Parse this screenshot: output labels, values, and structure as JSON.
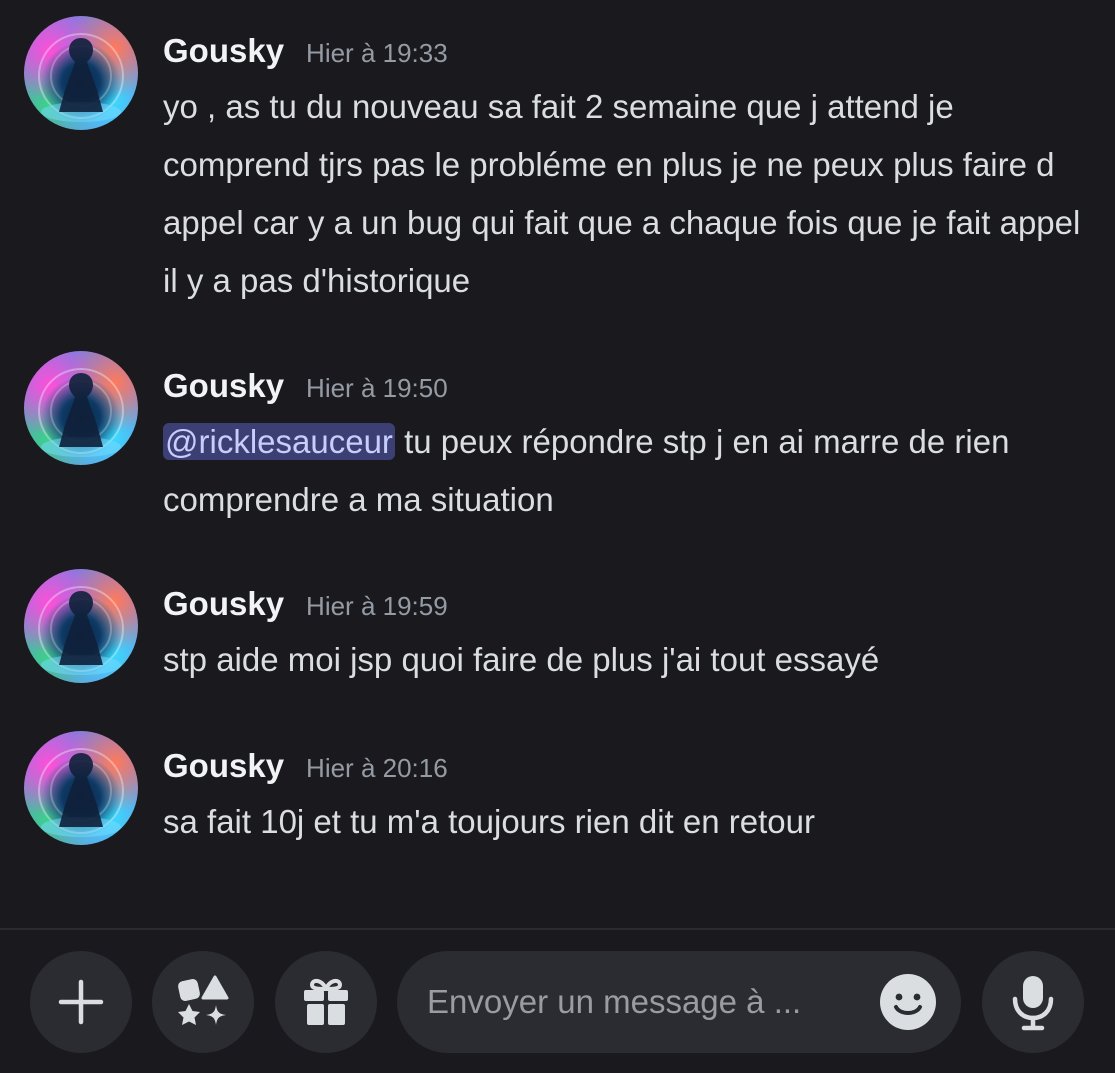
{
  "messages": [
    {
      "username": "Gousky",
      "timestamp": "Hier à 19:33",
      "text": "yo , as tu du nouveau sa fait 2 semaine que j attend je comprend tjrs pas le probléme en plus je ne peux plus faire d appel car y a un bug qui fait que a chaque fois que je fait appel il y a pas d'historique"
    },
    {
      "username": "Gousky",
      "timestamp": "Hier à 19:50",
      "mention": "@ricklesauceur",
      "text": " tu peux répondre stp j en ai marre de rien comprendre a ma situation"
    },
    {
      "username": "Gousky",
      "timestamp": "Hier à 19:59",
      "text": "stp aide moi jsp quoi faire de plus j'ai tout essayé"
    },
    {
      "username": "Gousky",
      "timestamp": "Hier à 20:16",
      "text": "sa fait 10j et tu m'a toujours rien dit en retour"
    }
  ],
  "composer": {
    "placeholder": "Envoyer un message à ...",
    "add_icon": "plus-icon",
    "apps_icon": "apps-icon",
    "gift_icon": "gift-icon",
    "emoji_icon": "emoji-icon",
    "mic_icon": "microphone-icon"
  },
  "colors": {
    "background": "#1a1a1e",
    "mention_bg": "#3c3f73",
    "mention_text": "#c9cdfb",
    "timestamp": "#949ba4",
    "button_bg": "#2b2c31"
  }
}
